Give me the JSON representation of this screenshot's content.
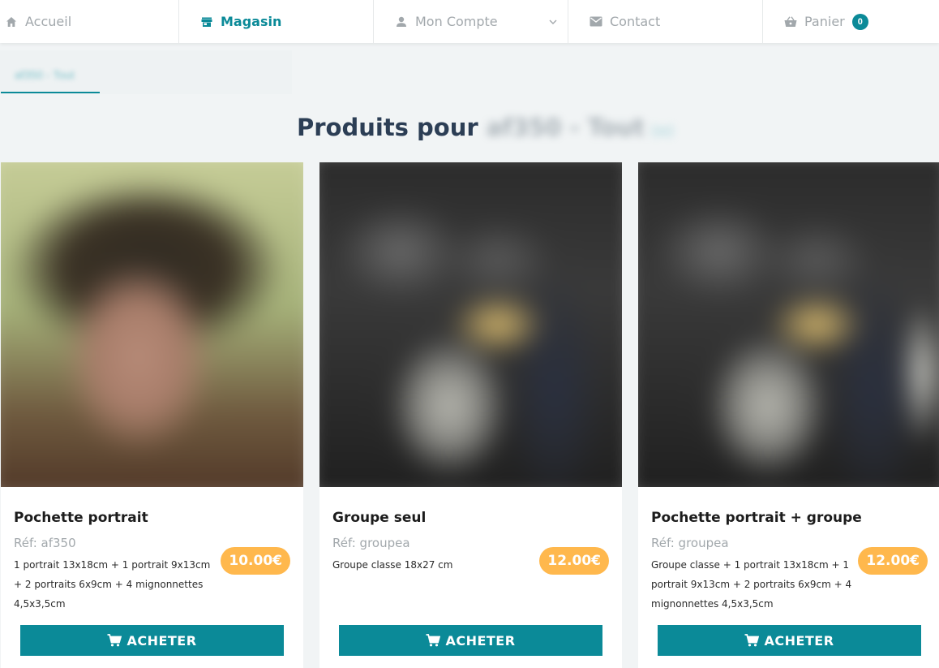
{
  "nav": {
    "items": [
      {
        "label": "Accueil",
        "icon": "home-icon"
      },
      {
        "label": "Magasin",
        "icon": "store-icon"
      },
      {
        "label": "Mon Compte",
        "icon": "user-icon"
      },
      {
        "label": "Contact",
        "icon": "mail-icon"
      },
      {
        "label": "Panier",
        "icon": "basket-icon",
        "count": "0"
      }
    ],
    "active_color": "#0b8a98"
  },
  "subtab": {
    "label": "af350 - Tout"
  },
  "heading": {
    "prefix": "Produits pour",
    "blurred": "af350 - Tout",
    "blurred_tail": "(x)"
  },
  "products": [
    {
      "title": "Pochette portrait",
      "ref": "Réf: af350",
      "description": "1 portrait 13x18cm + 1 portrait 9x13cm + 2 portraits 6x9cm + 4 mignonnettes 4,5x3,5cm",
      "price": "10.00€",
      "button": "ACHETER"
    },
    {
      "title": "Groupe seul",
      "ref": "Réf: groupea",
      "description": "Groupe classe 18x27 cm",
      "price": "12.00€",
      "button": "ACHETER"
    },
    {
      "title": "Pochette portrait + groupe",
      "ref": "Réf: groupea",
      "description": "Groupe classe + 1 portrait 13x18cm + 1 portrait 9x13cm + 2 portraits 6x9cm + 4 mignonnettes 4,5x3,5cm",
      "price": "12.00€",
      "button": "ACHETER"
    }
  ],
  "colors": {
    "accent": "#0b8a98",
    "price": "#ffb84d",
    "heading": "#2c3e55"
  }
}
